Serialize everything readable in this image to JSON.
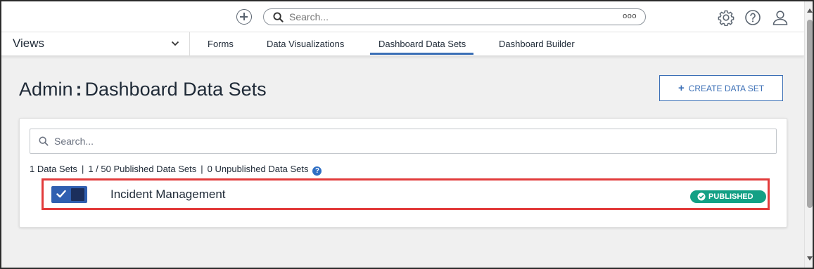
{
  "topbar": {
    "search_placeholder": "Search...",
    "more_label": "ooo",
    "icons": [
      "add-icon",
      "search-icon",
      "gear-icon",
      "help-icon",
      "user-icon"
    ]
  },
  "nav": {
    "views_label": "Views",
    "tabs": [
      {
        "label": "Forms",
        "active": false
      },
      {
        "label": "Data Visualizations",
        "active": false
      },
      {
        "label": "Dashboard Data Sets",
        "active": true
      },
      {
        "label": "Dashboard Builder",
        "active": false
      }
    ]
  },
  "page": {
    "title_prefix": "Admin",
    "title_separator": ":",
    "title_main": "Dashboard Data Sets",
    "create_button_label": "CREATE DATA SET"
  },
  "card": {
    "search_placeholder": "Search...",
    "stats": {
      "data_sets": "1 Data Sets",
      "published": "1 / 50 Published Data Sets",
      "unpublished": "0 Unpublished Data Sets",
      "divider": "|"
    },
    "rows": [
      {
        "name": "Incident Management",
        "enabled": true,
        "status": "PUBLISHED"
      }
    ]
  },
  "colors": {
    "accent": "#3b6fb6",
    "published_badge": "#13a085",
    "highlight_border": "#e23b3b",
    "toggle_on": "#2f5fb0"
  }
}
